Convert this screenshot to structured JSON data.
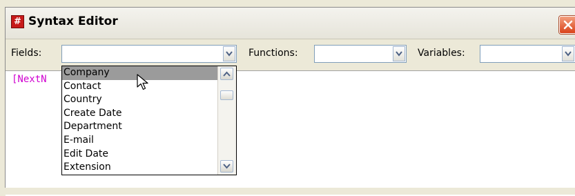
{
  "window": {
    "title": "Syntax Editor",
    "app_icon_glyph": "#"
  },
  "toolbar": {
    "fields_label": "Fields:",
    "fields_value": "",
    "functions_label": "Functions:",
    "functions_value": "",
    "variables_label": "Variables:",
    "variables_value": ""
  },
  "editor": {
    "code_text": "[NextN"
  },
  "fields_dropdown": {
    "items": [
      "Company",
      "Contact",
      "Country",
      "Create Date",
      "Department",
      "E-mail",
      "Edit Date",
      "Extension"
    ],
    "selected": "Company"
  },
  "colors": {
    "syntax_field": "#d000d0",
    "selection": "#9b9b9b",
    "close_button": "#d9421a",
    "window_bg": "#ece9d8"
  },
  "icons": {
    "close": "close-icon",
    "app": "app-icon",
    "dropdown": "chevron-down-icon",
    "scroll_up": "chevron-up-icon",
    "scroll_down": "chevron-down-icon",
    "pointer": "mouse-cursor-icon"
  }
}
